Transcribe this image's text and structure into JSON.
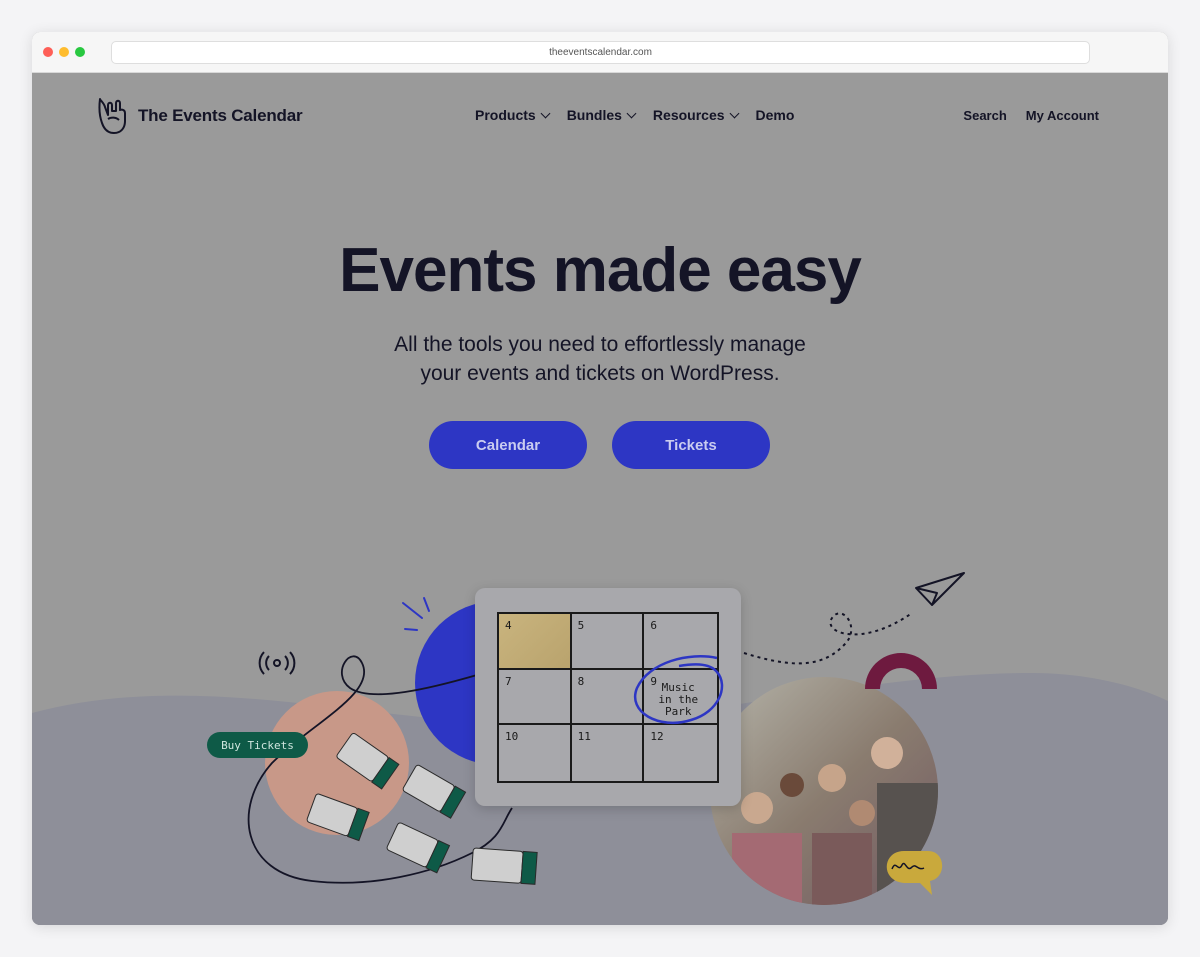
{
  "browser": {
    "url": "theeventscalendar.com"
  },
  "header": {
    "brand": "The Events Calendar",
    "nav": [
      {
        "label": "Products",
        "has_dropdown": true
      },
      {
        "label": "Bundles",
        "has_dropdown": true
      },
      {
        "label": "Resources",
        "has_dropdown": true
      },
      {
        "label": "Demo",
        "has_dropdown": false
      }
    ],
    "utility": {
      "search": "Search",
      "account": "My Account"
    }
  },
  "hero": {
    "title": "Events made easy",
    "subtitle_line1": "All the tools you need to effortlessly manage",
    "subtitle_line2": "your events and tickets on WordPress.",
    "buttons": {
      "calendar": "Calendar",
      "tickets": "Tickets"
    }
  },
  "illustration": {
    "buy_tickets": "Buy Tickets",
    "calendar_days": [
      "4",
      "5",
      "6",
      "7",
      "8",
      "9",
      "10",
      "11",
      "12"
    ],
    "event_lines": [
      "Music",
      "in the",
      "Park"
    ]
  },
  "colors": {
    "overlay_gray": "#9a9a9a",
    "primary_blue": "#2d36c4",
    "dark_text": "#141426",
    "ticket_green": "#0e5a47",
    "salmon": "#c89888",
    "maroon": "#6e1a3f",
    "speech_yellow": "#c9a93c"
  },
  "icons": [
    "rock-hand-logo-icon",
    "chevron-down-icon",
    "broadcast-icon",
    "paper-plane-icon",
    "speech-bubble-icon"
  ]
}
